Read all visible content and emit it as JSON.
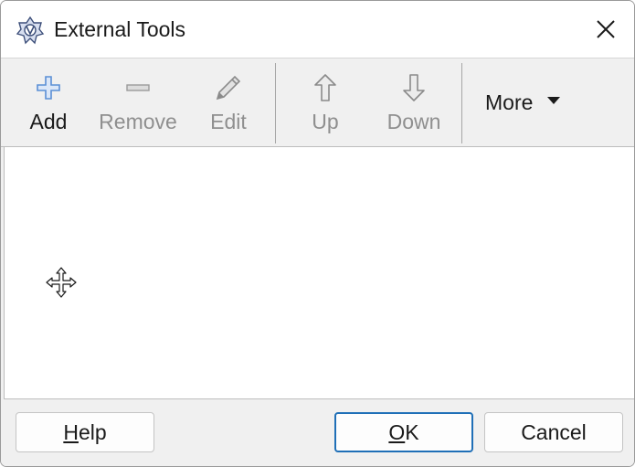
{
  "window": {
    "title": "External Tools"
  },
  "toolbar": {
    "add": {
      "label": "Add",
      "enabled": true
    },
    "remove": {
      "label": "Remove",
      "enabled": false
    },
    "edit": {
      "label": "Edit",
      "enabled": false
    },
    "up": {
      "label": "Up",
      "enabled": false
    },
    "down": {
      "label": "Down",
      "enabled": false
    },
    "more": {
      "label": "More"
    }
  },
  "list": {
    "items": []
  },
  "footer": {
    "help": {
      "mnemonic": "H",
      "rest": "elp"
    },
    "ok": {
      "mnemonic": "O",
      "rest": "K"
    },
    "cancel": {
      "label": "Cancel"
    }
  },
  "colors": {
    "accent": "#1f6fb7",
    "add_icon": "#5b8fd6",
    "disabled_text": "#8f8f8f"
  },
  "icons": [
    "app-icon",
    "close-icon",
    "plus-icon",
    "minus-icon",
    "pencil-icon",
    "arrow-up-icon",
    "arrow-down-icon",
    "chevron-down-icon",
    "move-cursor-icon"
  ]
}
